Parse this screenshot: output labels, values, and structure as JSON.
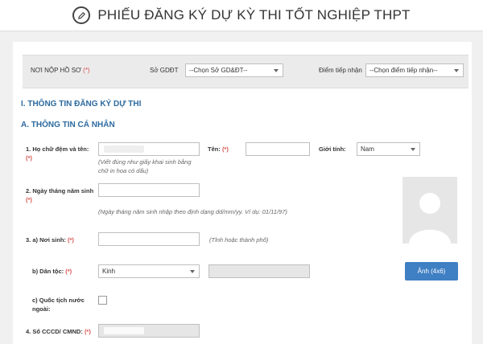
{
  "header": {
    "title": "PHIẾU ĐĂNG KÝ DỰ KỲ THI TỐT NGHIỆP THPT",
    "icon": "edit-icon"
  },
  "filter": {
    "submit_place_label": "NƠI NỘP HỒ SƠ",
    "required_mark": "(*)",
    "so_gddt_label": "Sở GDĐT",
    "so_gddt_value": "--Chọn Sở GD&ĐT--",
    "reception_label": "Điểm tiếp nhận",
    "reception_value": "--Chọn điểm tiếp nhận--"
  },
  "sections": {
    "registration": "I. THÔNG TIN ĐĂNG KÝ DỰ THI",
    "personal": "A. THÔNG TIN CÁ NHÂN"
  },
  "fields": {
    "middle_name_label": "1. Họ chữ đệm và tên:",
    "middle_name_hint": "(Viết đúng như giấy khai sinh bằng chữ in hoa có dấu)",
    "first_name_label": "Tên:",
    "gender_label": "Giới tính:",
    "gender_value": "Nam",
    "dob_label": "2. Ngày tháng năm sinh",
    "dob_hint": "(Ngày tháng năm sinh nhập theo định dạng dd/mm/yy. Ví dụ: 01/11/97)",
    "birthplace_label": "3. a) Nơi sinh:",
    "birthplace_hint": "(Tỉnh hoặc thành phố)",
    "ethnicity_label": "b) Dân tộc:",
    "ethnicity_value": "Kinh",
    "foreign_label": "c) Quốc tịch nước ngoài:",
    "id_label": "4. Số CCCD/ CMND:"
  },
  "photo": {
    "button_label": "Ảnh (4x6)",
    "icon": "person-silhouette-icon"
  },
  "colors": {
    "accent": "#2d6a9f",
    "button": "#3f7fc3",
    "required": "#d9534f"
  }
}
